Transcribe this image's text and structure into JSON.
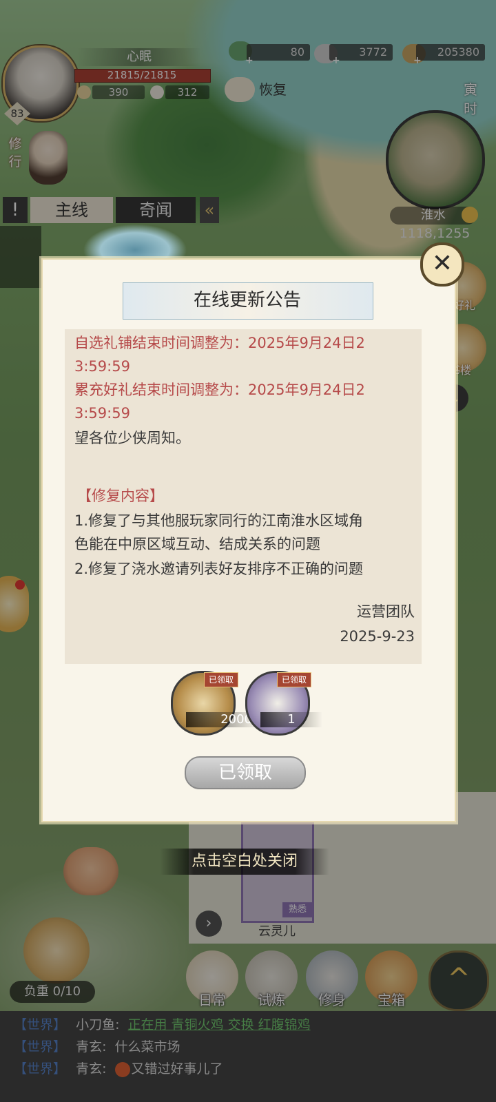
{
  "hud": {
    "player_name": "心眠",
    "level": "83",
    "hp": "21815/21815",
    "stat1": "390",
    "stat2": "312",
    "currency1": "80",
    "currency2": "3772",
    "currency3": "205380",
    "recover_label": "恢复",
    "time_label": "寅时",
    "region": "淮水",
    "coords": "1118,1255",
    "practice_label": "修行"
  },
  "quest": {
    "tab_main": "主线",
    "tab_rumor": "奇闻",
    "info_icon": "!"
  },
  "side": {
    "gift_label": "充好礼",
    "building_label": "书楼"
  },
  "modal": {
    "title": "在线更新公告",
    "close_symbol": "✕",
    "lines": [
      "自选礼铺结束时间调整为：2025年9月24日2",
      "3:59:59",
      "累充好礼结束时间调整为：2025年9月24日2",
      "3:59:59",
      "望各位少侠周知。",
      "【修复内容】",
      "1.修复了与其他服玩家同行的江南淮水区域角",
      "色能在中原区域互动、结成关系的问题",
      "2.修复了浇水邀请列表好友排序不正确的问题",
      "运营团队",
      "2025-9-23"
    ],
    "rewards": [
      {
        "tag": "已领取",
        "count": "2000"
      },
      {
        "tag": "已领取",
        "count": "1"
      }
    ],
    "claim_button": "已领取"
  },
  "tap_hint": "点击空白处关闭",
  "npc": {
    "name": "云灵儿",
    "tag": "熟悉",
    "arrow": "›"
  },
  "load": "负重 0/10",
  "menu": [
    {
      "label": "日常"
    },
    {
      "label": "试炼"
    },
    {
      "label": "修身"
    },
    {
      "label": "宝箱"
    }
  ],
  "expand_symbol": "^",
  "chat": [
    {
      "channel": "【世界】",
      "sender": "小刀鱼:",
      "link": "正在用 青铜火鸡 交换 红腹锦鸡",
      "text": ""
    },
    {
      "channel": "【世界】",
      "sender": "青玄:",
      "link": "",
      "text": "什么菜市场"
    },
    {
      "channel": "【世界】",
      "sender": "青玄:",
      "link": "",
      "text": "又错过好事儿了"
    }
  ],
  "colors": {
    "notice_red": "#b64a4a",
    "chat_channel": "#4f7dc9",
    "chat_link": "#6cc96a",
    "hp_bar": "#a9382a"
  }
}
